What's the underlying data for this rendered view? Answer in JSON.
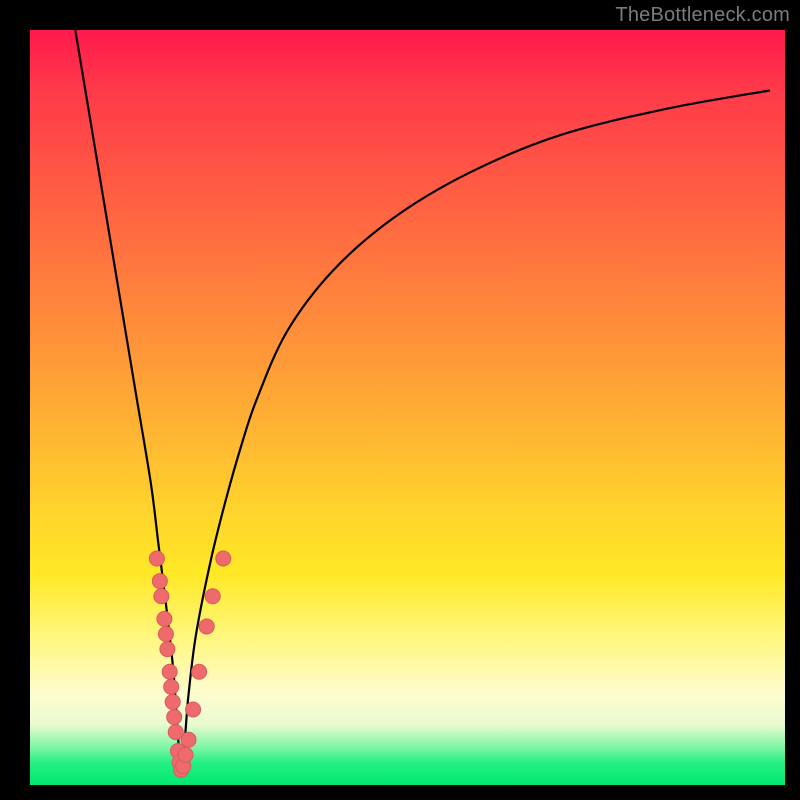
{
  "watermark": "TheBottleneck.com",
  "colors": {
    "frame": "#000000",
    "curve": "#000000",
    "dot_fill": "#ee6a6c",
    "dot_stroke": "#d95a5d"
  },
  "chart_data": {
    "type": "line",
    "title": "",
    "xlabel": "",
    "ylabel": "",
    "xlim": [
      0,
      100
    ],
    "ylim": [
      0,
      100
    ],
    "grid": false,
    "legend": false,
    "series": [
      {
        "name": "bottleneck-curve",
        "x": [
          6,
          8,
          10,
          12,
          14,
          16,
          17,
          18,
          19,
          19.5,
          20,
          20.5,
          21,
          22,
          24,
          26,
          28,
          30,
          34,
          40,
          48,
          58,
          70,
          84,
          98
        ],
        "y": [
          100,
          88,
          76,
          64,
          52,
          40,
          32,
          24,
          15,
          8,
          2,
          6,
          12,
          20,
          30,
          38,
          45,
          51,
          60,
          68,
          75,
          81,
          86,
          89.5,
          92
        ]
      }
    ],
    "points": [
      {
        "name": "left-cluster",
        "x": 16.8,
        "y": 30
      },
      {
        "name": "left-cluster",
        "x": 17.2,
        "y": 27
      },
      {
        "name": "left-cluster",
        "x": 17.4,
        "y": 25
      },
      {
        "name": "left-cluster",
        "x": 17.8,
        "y": 22
      },
      {
        "name": "left-cluster",
        "x": 18.0,
        "y": 20
      },
      {
        "name": "left-cluster",
        "x": 18.2,
        "y": 18
      },
      {
        "name": "left-cluster",
        "x": 18.5,
        "y": 15
      },
      {
        "name": "left-cluster",
        "x": 18.7,
        "y": 13
      },
      {
        "name": "left-cluster",
        "x": 18.9,
        "y": 11
      },
      {
        "name": "left-cluster",
        "x": 19.1,
        "y": 9
      },
      {
        "name": "left-cluster",
        "x": 19.3,
        "y": 7
      },
      {
        "name": "bottom-cluster",
        "x": 19.6,
        "y": 4.5
      },
      {
        "name": "bottom-cluster",
        "x": 19.8,
        "y": 3
      },
      {
        "name": "bottom-cluster",
        "x": 20.0,
        "y": 2
      },
      {
        "name": "bottom-cluster",
        "x": 20.3,
        "y": 2.5
      },
      {
        "name": "bottom-cluster",
        "x": 20.6,
        "y": 4
      },
      {
        "name": "bottom-cluster",
        "x": 21.0,
        "y": 6
      },
      {
        "name": "right-cluster",
        "x": 21.6,
        "y": 10
      },
      {
        "name": "right-cluster",
        "x": 22.4,
        "y": 15
      },
      {
        "name": "right-cluster",
        "x": 23.4,
        "y": 21
      },
      {
        "name": "right-cluster",
        "x": 24.2,
        "y": 25
      },
      {
        "name": "right-cluster",
        "x": 25.6,
        "y": 30
      }
    ]
  }
}
